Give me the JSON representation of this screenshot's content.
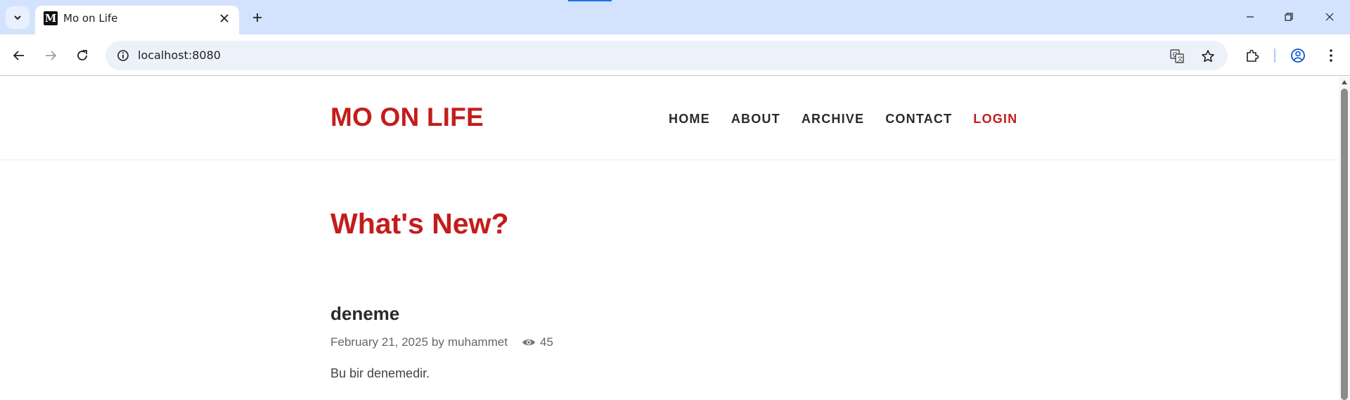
{
  "browser": {
    "tab": {
      "title": "Mo on Life",
      "favicon_letter": "M"
    },
    "address": {
      "url": "localhost:8080"
    },
    "icons": {
      "tab_search": "chevron-down-icon",
      "close_tab": "close-icon",
      "new_tab": "plus-icon",
      "minimize": "minimize-icon",
      "restore": "restore-icon",
      "close_window": "close-icon",
      "back": "arrow-left-icon",
      "forward": "arrow-right-icon",
      "reload": "reload-icon",
      "site_info": "info-icon",
      "translate": "translate-icon",
      "bookmark": "star-icon",
      "extensions": "puzzle-icon",
      "profile": "account-icon",
      "menu": "kebab-menu-icon"
    }
  },
  "site": {
    "brand": "MO ON LIFE",
    "nav": [
      {
        "label": "HOME"
      },
      {
        "label": "ABOUT"
      },
      {
        "label": "ARCHIVE"
      },
      {
        "label": "CONTACT"
      },
      {
        "label": "LOGIN"
      }
    ],
    "accent_color": "#c41c1c"
  },
  "main": {
    "heading": "What's New?",
    "posts": [
      {
        "title": "deneme",
        "date": "February 21, 2025",
        "author_prefix": "by",
        "author": "muhammet",
        "views": "45",
        "excerpt": "Bu bir denemedir."
      }
    ]
  }
}
